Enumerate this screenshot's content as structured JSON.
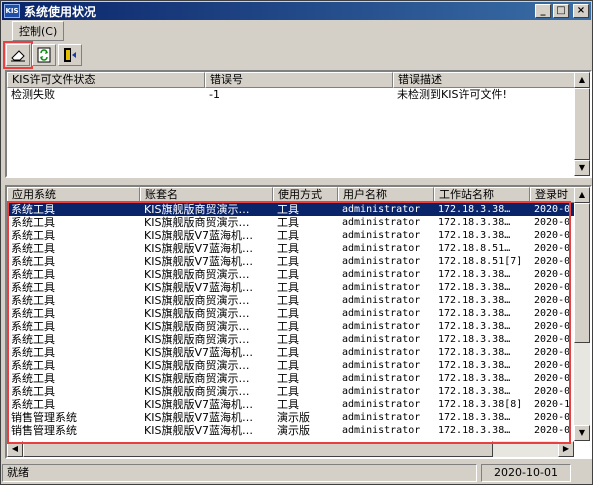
{
  "window": {
    "title": "系统使用状况",
    "icon_text": "KIS",
    "buttons": [
      "minimize",
      "maximize",
      "close"
    ]
  },
  "menu": {
    "items": [
      {
        "label": "控制(C)"
      }
    ]
  },
  "toolbar": {
    "tools": [
      {
        "name": "eraser-icon",
        "highlighted": true
      },
      {
        "name": "refresh-icon",
        "highlighted": false
      },
      {
        "name": "exit-door-icon",
        "highlighted": false
      }
    ]
  },
  "license_panel": {
    "headers": [
      "KIS许可文件状态",
      "错误号",
      "错误描述"
    ],
    "rows": [
      [
        "检测失败",
        "-1",
        "未检测到KIS许可文件!"
      ]
    ]
  },
  "usage_panel": {
    "headers": [
      "应用系统",
      "账套名",
      "使用方式",
      "用户名称",
      "工作站名称",
      "登录时"
    ],
    "rows": [
      [
        "系统工具",
        "KIS旗舰版商贸演示…",
        "工具",
        "administrator",
        "172.18.3.38…",
        "2020-0"
      ],
      [
        "系统工具",
        "KIS旗舰版商贸演示…",
        "工具",
        "administrator",
        "172.18.3.38…",
        "2020-0"
      ],
      [
        "系统工具",
        "KIS旗舰版V7蓝海机…",
        "工具",
        "administrator",
        "172.18.3.38…",
        "2020-0"
      ],
      [
        "系统工具",
        "KIS旗舰版V7蓝海机…",
        "工具",
        "administrator",
        "172.18.8.51…",
        "2020-0"
      ],
      [
        "系统工具",
        "KIS旗舰版V7蓝海机…",
        "工具",
        "administrator",
        "172.18.8.51[7]",
        "2020-0"
      ],
      [
        "系统工具",
        "KIS旗舰版商贸演示…",
        "工具",
        "administrator",
        "172.18.3.38…",
        "2020-0"
      ],
      [
        "系统工具",
        "KIS旗舰版V7蓝海机…",
        "工具",
        "administrator",
        "172.18.3.38…",
        "2020-0"
      ],
      [
        "系统工具",
        "KIS旗舰版商贸演示…",
        "工具",
        "administrator",
        "172.18.3.38…",
        "2020-0"
      ],
      [
        "系统工具",
        "KIS旗舰版商贸演示…",
        "工具",
        "administrator",
        "172.18.3.38…",
        "2020-0"
      ],
      [
        "系统工具",
        "KIS旗舰版商贸演示…",
        "工具",
        "administrator",
        "172.18.3.38…",
        "2020-0"
      ],
      [
        "系统工具",
        "KIS旗舰版商贸演示…",
        "工具",
        "administrator",
        "172.18.3.38…",
        "2020-0"
      ],
      [
        "系统工具",
        "KIS旗舰版V7蓝海机…",
        "工具",
        "administrator",
        "172.18.3.38…",
        "2020-0"
      ],
      [
        "系统工具",
        "KIS旗舰版商贸演示…",
        "工具",
        "administrator",
        "172.18.3.38…",
        "2020-0"
      ],
      [
        "系统工具",
        "KIS旗舰版商贸演示…",
        "工具",
        "administrator",
        "172.18.3.38…",
        "2020-0"
      ],
      [
        "系统工具",
        "KIS旗舰版商贸演示…",
        "工具",
        "administrator",
        "172.18.3.38…",
        "2020-0"
      ],
      [
        "系统工具",
        "KIS旗舰版V7蓝海机…",
        "工具",
        "administrator",
        "172.18.3.38[8]",
        "2020-1"
      ],
      [
        "销售管理系统",
        "KIS旗舰版V7蓝海机…",
        "演示版",
        "administrator",
        "172.18.3.38…",
        "2020-0"
      ],
      [
        "销售管理系统",
        "KIS旗舰版V7蓝海机…",
        "演示版",
        "administrator",
        "172.18.3.38…",
        "2020-0"
      ]
    ]
  },
  "status": {
    "left": "就绪",
    "date": "2020-10-01"
  },
  "colors": {
    "highlight_red": "#e84040",
    "selection": "#0a246a"
  }
}
